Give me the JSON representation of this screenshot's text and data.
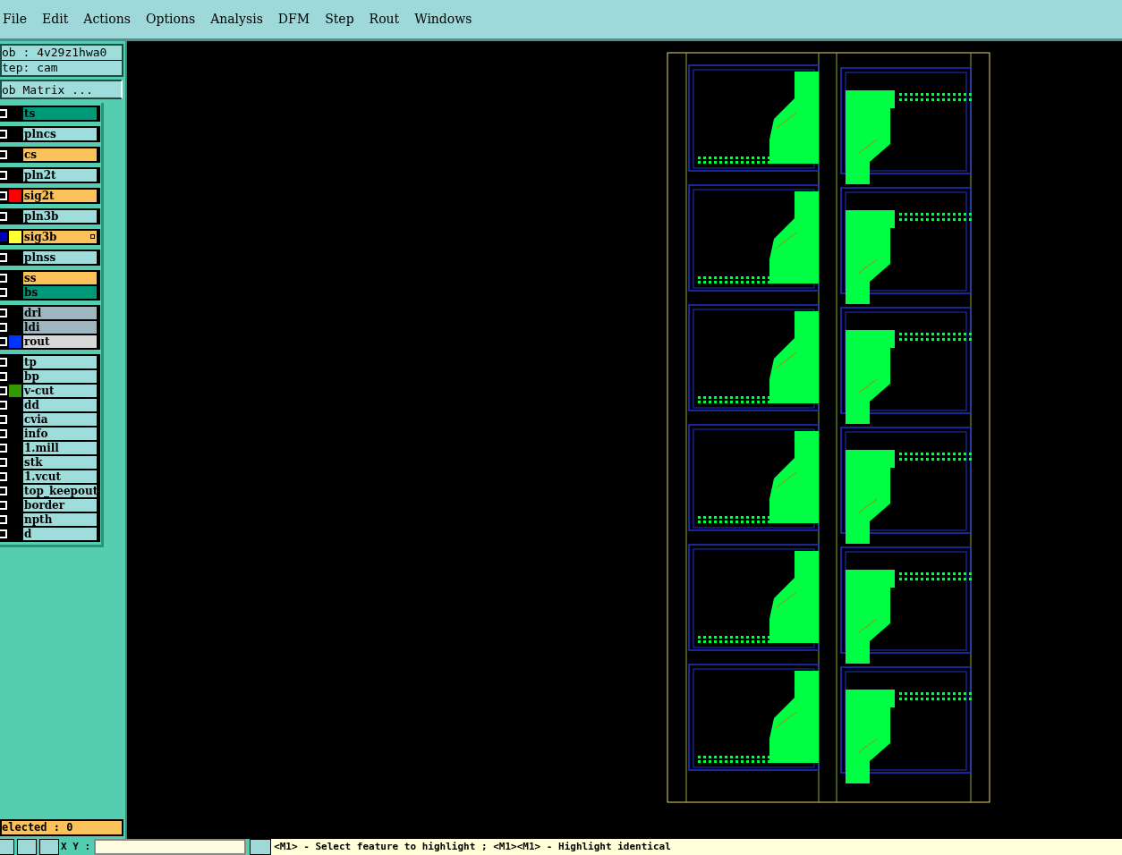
{
  "menu": [
    {
      "label": "File"
    },
    {
      "label": "Edit"
    },
    {
      "label": "Actions"
    },
    {
      "label": "Options"
    },
    {
      "label": "Analysis"
    },
    {
      "label": "DFM"
    },
    {
      "label": "Step"
    },
    {
      "label": "Rout"
    },
    {
      "label": "Windows"
    }
  ],
  "job": "ob : 4v29z1hwa0",
  "step": "tep: cam",
  "job_matrix_button": "ob Matrix ...",
  "layer_groups": [
    {
      "layers": [
        {
          "name": "ts",
          "kind": "mask",
          "work": false
        }
      ]
    },
    {
      "layers": [
        {
          "name": "plncs",
          "kind": "plane",
          "work": false
        }
      ]
    },
    {
      "layers": [
        {
          "name": "cs",
          "kind": "signal",
          "work": false
        }
      ]
    },
    {
      "layers": [
        {
          "name": "pln2t",
          "kind": "plane",
          "work": false
        }
      ]
    },
    {
      "layers": [
        {
          "name": "sig2t",
          "kind": "signal",
          "work": false,
          "color": "#ff0000"
        }
      ]
    },
    {
      "layers": [
        {
          "name": "pln3b",
          "kind": "plane",
          "work": false
        }
      ]
    },
    {
      "layers": [
        {
          "name": "sig3b",
          "kind": "signal",
          "work": true,
          "color": "#ffff33"
        }
      ]
    },
    {
      "layers": [
        {
          "name": "plnss",
          "kind": "plane",
          "work": false
        }
      ]
    },
    {
      "layers": [
        {
          "name": "ss",
          "kind": "signal",
          "work": false
        },
        {
          "name": "bs",
          "kind": "mask",
          "work": false
        }
      ]
    },
    {
      "layers": [
        {
          "name": "drl",
          "kind": "drill",
          "work": false
        },
        {
          "name": "ldi",
          "kind": "drill",
          "work": false
        },
        {
          "name": "rout",
          "kind": "rout",
          "work": false,
          "color": "#0033ff"
        }
      ]
    },
    {
      "layers": [
        {
          "name": "tp",
          "kind": "misc",
          "work": false
        },
        {
          "name": "bp",
          "kind": "misc",
          "work": false
        },
        {
          "name": "v-cut",
          "kind": "misc",
          "work": false,
          "color": "#339900"
        },
        {
          "name": "dd",
          "kind": "misc",
          "work": false
        },
        {
          "name": "cvia",
          "kind": "misc",
          "work": false
        },
        {
          "name": "info",
          "kind": "misc",
          "work": false
        },
        {
          "name": "1.mill",
          "kind": "misc",
          "work": false
        },
        {
          "name": "stk",
          "kind": "misc",
          "work": false
        },
        {
          "name": "1.vcut",
          "kind": "misc",
          "work": false
        },
        {
          "name": "top_keepout",
          "kind": "misc",
          "work": false
        },
        {
          "name": "border",
          "kind": "misc",
          "work": false
        },
        {
          "name": "npth",
          "kind": "misc",
          "work": false
        },
        {
          "name": "d",
          "kind": "misc",
          "work": false
        }
      ]
    }
  ],
  "selected_count": "elected : 0",
  "coordinates_label": "X Y :",
  "status_message": "<M1> - Select feature to highlight ; <M1><M1> - Highlight identical"
}
